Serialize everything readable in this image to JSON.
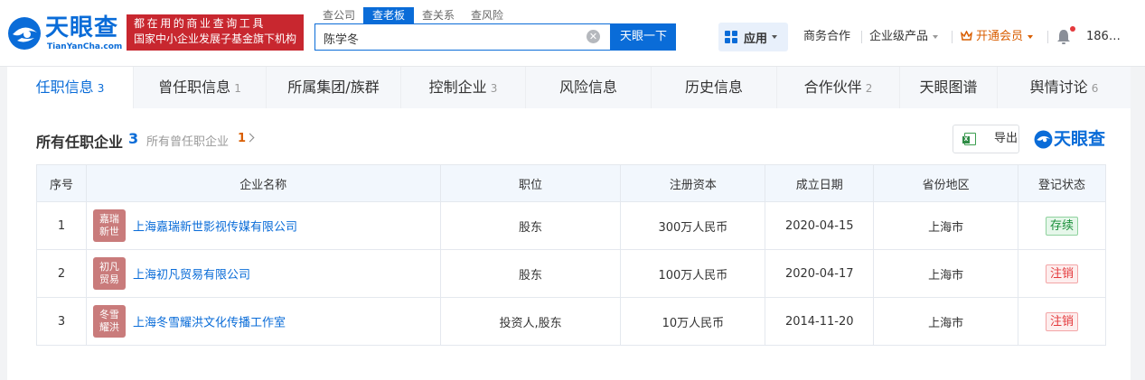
{
  "header": {
    "logo_cn": "天眼查",
    "logo_en": "TianYanCha.com",
    "slogan_line1": "都在用的商业查询工具",
    "slogan_line2": "国家中小企业发展子基金旗下机构",
    "search_tabs": [
      "查公司",
      "查老板",
      "查关系",
      "查风险"
    ],
    "search_tab_active": "查老板",
    "search_value": "陈学冬",
    "search_button": "天眼一下",
    "apps_label": "应用",
    "nav": {
      "business": "商务合作",
      "enterprise": "企业级产品",
      "vip": "开通会员",
      "phone": "186"
    },
    "phone_ellipsis": "…"
  },
  "tabs": [
    {
      "label": "任职信息",
      "count": "3",
      "active": true
    },
    {
      "label": "曾任职信息",
      "count": "1"
    },
    {
      "label": "所属集团/族群",
      "count": ""
    },
    {
      "label": "控制企业",
      "count": "3"
    },
    {
      "label": "风险信息",
      "count": ""
    },
    {
      "label": "历史信息",
      "count": ""
    },
    {
      "label": "合作伙伴",
      "count": "2"
    },
    {
      "label": "天眼图谱",
      "count": ""
    },
    {
      "label": "舆情讨论",
      "count": "6"
    }
  ],
  "panel": {
    "title": "所有任职企业",
    "count": "3",
    "former_link": "所有曾任职企业",
    "former_count": "1",
    "export_label": "导出",
    "watermark": "天眼查"
  },
  "table": {
    "headers": {
      "no": "序号",
      "name": "企业名称",
      "position": "职位",
      "capital": "注册资本",
      "date": "成立日期",
      "region": "省份地区",
      "status": "登记状态"
    },
    "rows": [
      {
        "no": "1",
        "logo1": "嘉瑞",
        "logo2": "新世",
        "name": "上海嘉瑞新世影视传媒有限公司",
        "position": "股东",
        "capital": "300万人民币",
        "date": "2020-04-15",
        "region": "上海市",
        "status": "存续"
      },
      {
        "no": "2",
        "logo1": "初凡",
        "logo2": "贸易",
        "name": "上海初凡贸易有限公司",
        "position": "股东",
        "capital": "100万人民币",
        "date": "2020-04-17",
        "region": "上海市",
        "status": "注销"
      },
      {
        "no": "3",
        "logo1": "冬雪",
        "logo2": "耀洪",
        "name": "上海冬雪耀洪文化传播工作室",
        "position": "投资人,股东",
        "capital": "10万人民币",
        "date": "2014-11-20",
        "region": "上海市",
        "status": "注销"
      }
    ]
  },
  "colors": {
    "brand": "#0a6cd8",
    "slogan_bg": "#c8272f",
    "vip": "#d95e00",
    "status_active": "#1a8f3a",
    "status_cancelled": "#e4393c",
    "company_logo_bg": "#c97b7b"
  }
}
